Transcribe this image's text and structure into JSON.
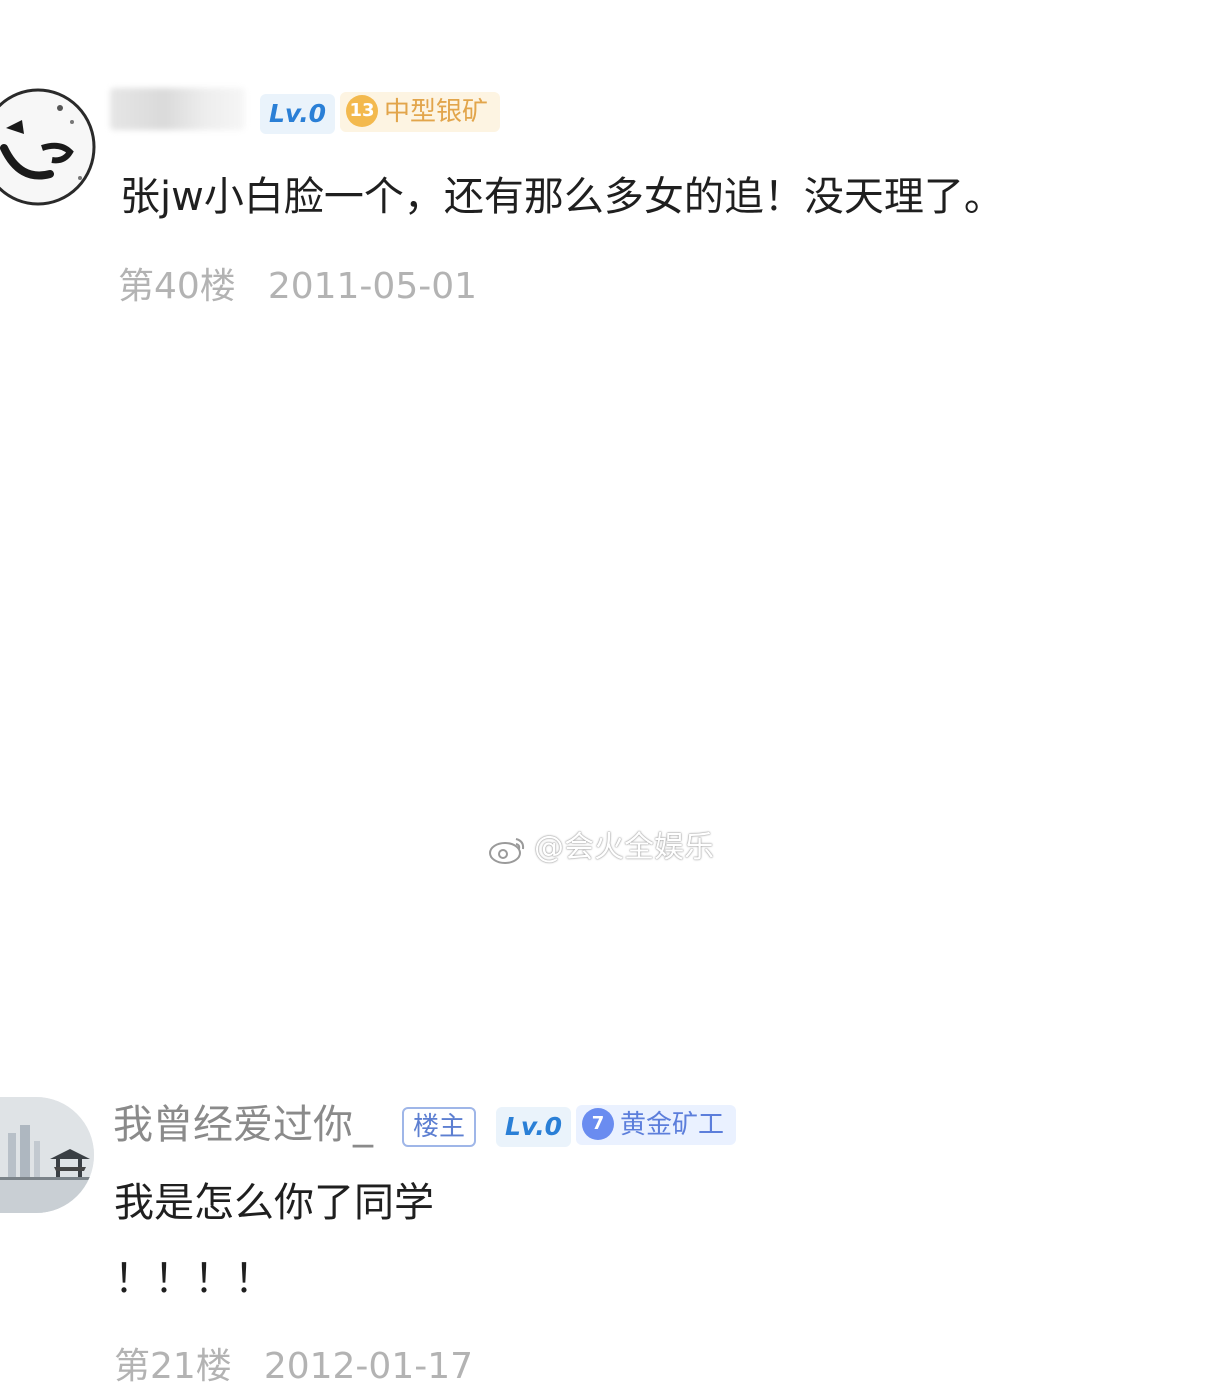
{
  "posts": [
    {
      "level_badge": "Lv.0",
      "rank_num": "13",
      "rank_name": "中型银矿",
      "content_lines": [
        "张jw小白脸一个，还有那么多女的追！没天理了。"
      ],
      "floor": "第40楼",
      "date": "2011-05-01"
    },
    {
      "username": "我曾经爱过你_",
      "owner_badge": "楼主",
      "level_badge": "Lv.0",
      "rank_num": "7",
      "rank_name": "黄金矿工",
      "content_lines": [
        "我是怎么你了同学",
        "！！！！"
      ],
      "floor": "第21楼",
      "date": "2012-01-17"
    }
  ],
  "watermark": "@会火全娱乐",
  "colors": {
    "meta_gray": "#b3b3b3",
    "level_blue": "#2a7fd6",
    "silver_badge": "#e2a54b",
    "gold_badge": "#5c7edb"
  }
}
